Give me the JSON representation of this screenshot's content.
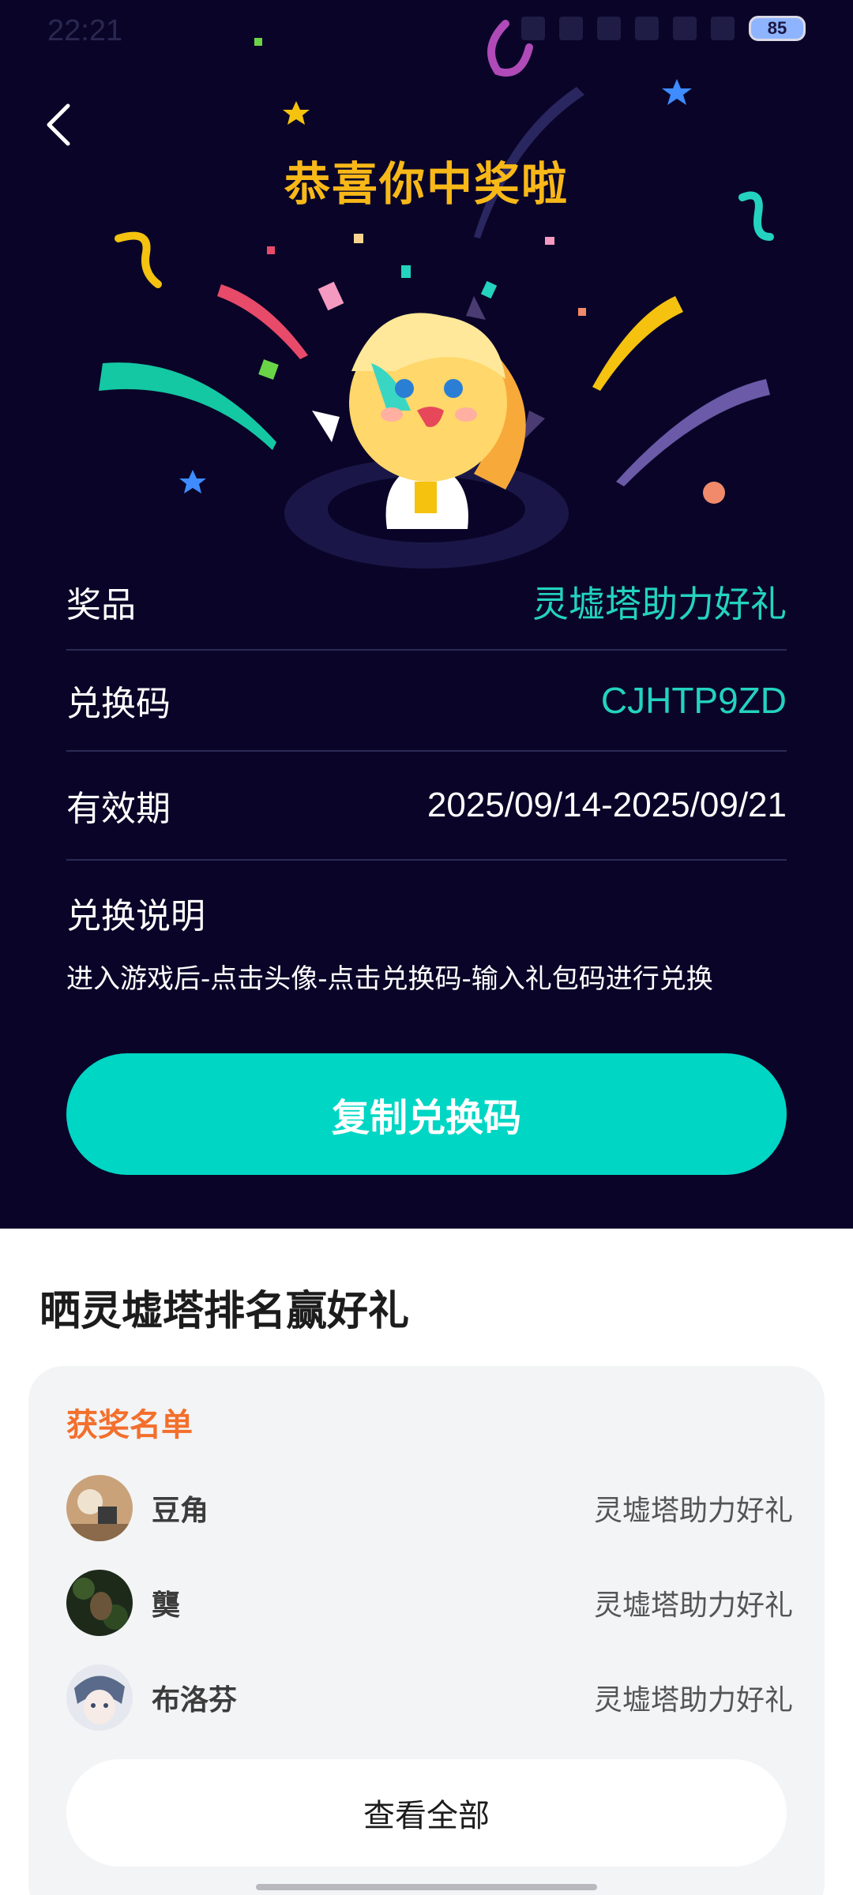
{
  "status_bar": {
    "time": "22:21",
    "battery": "85"
  },
  "header": {
    "back_icon": "chevron-left-icon",
    "title": "恭喜你中奖啦"
  },
  "prize": {
    "prize_label": "奖品",
    "prize_value": "灵墟塔助力好礼",
    "code_label": "兑换码",
    "code_value": "CJHTP9ZD",
    "valid_label": "有效期",
    "valid_value": "2025/09/14-2025/09/21",
    "instruction_title": "兑换说明",
    "instruction_text": "进入游戏后-点击头像-点击兑换码-输入礼包码进行兑换",
    "copy_button": "复制兑换码"
  },
  "promo": {
    "title": "晒灵墟塔排名赢好礼",
    "winners_title": "获奖名单",
    "winners": [
      {
        "name": "豆角",
        "prize": "灵墟塔助力好礼"
      },
      {
        "name": "龑",
        "prize": "灵墟塔助力好礼"
      },
      {
        "name": "布洛芬",
        "prize": "灵墟塔助力好礼"
      }
    ],
    "view_all": "查看全部"
  },
  "colors": {
    "background": "#0a0528",
    "accent": "#00d6c4",
    "title": "#f8b818",
    "winners_title": "#f36f2c"
  }
}
